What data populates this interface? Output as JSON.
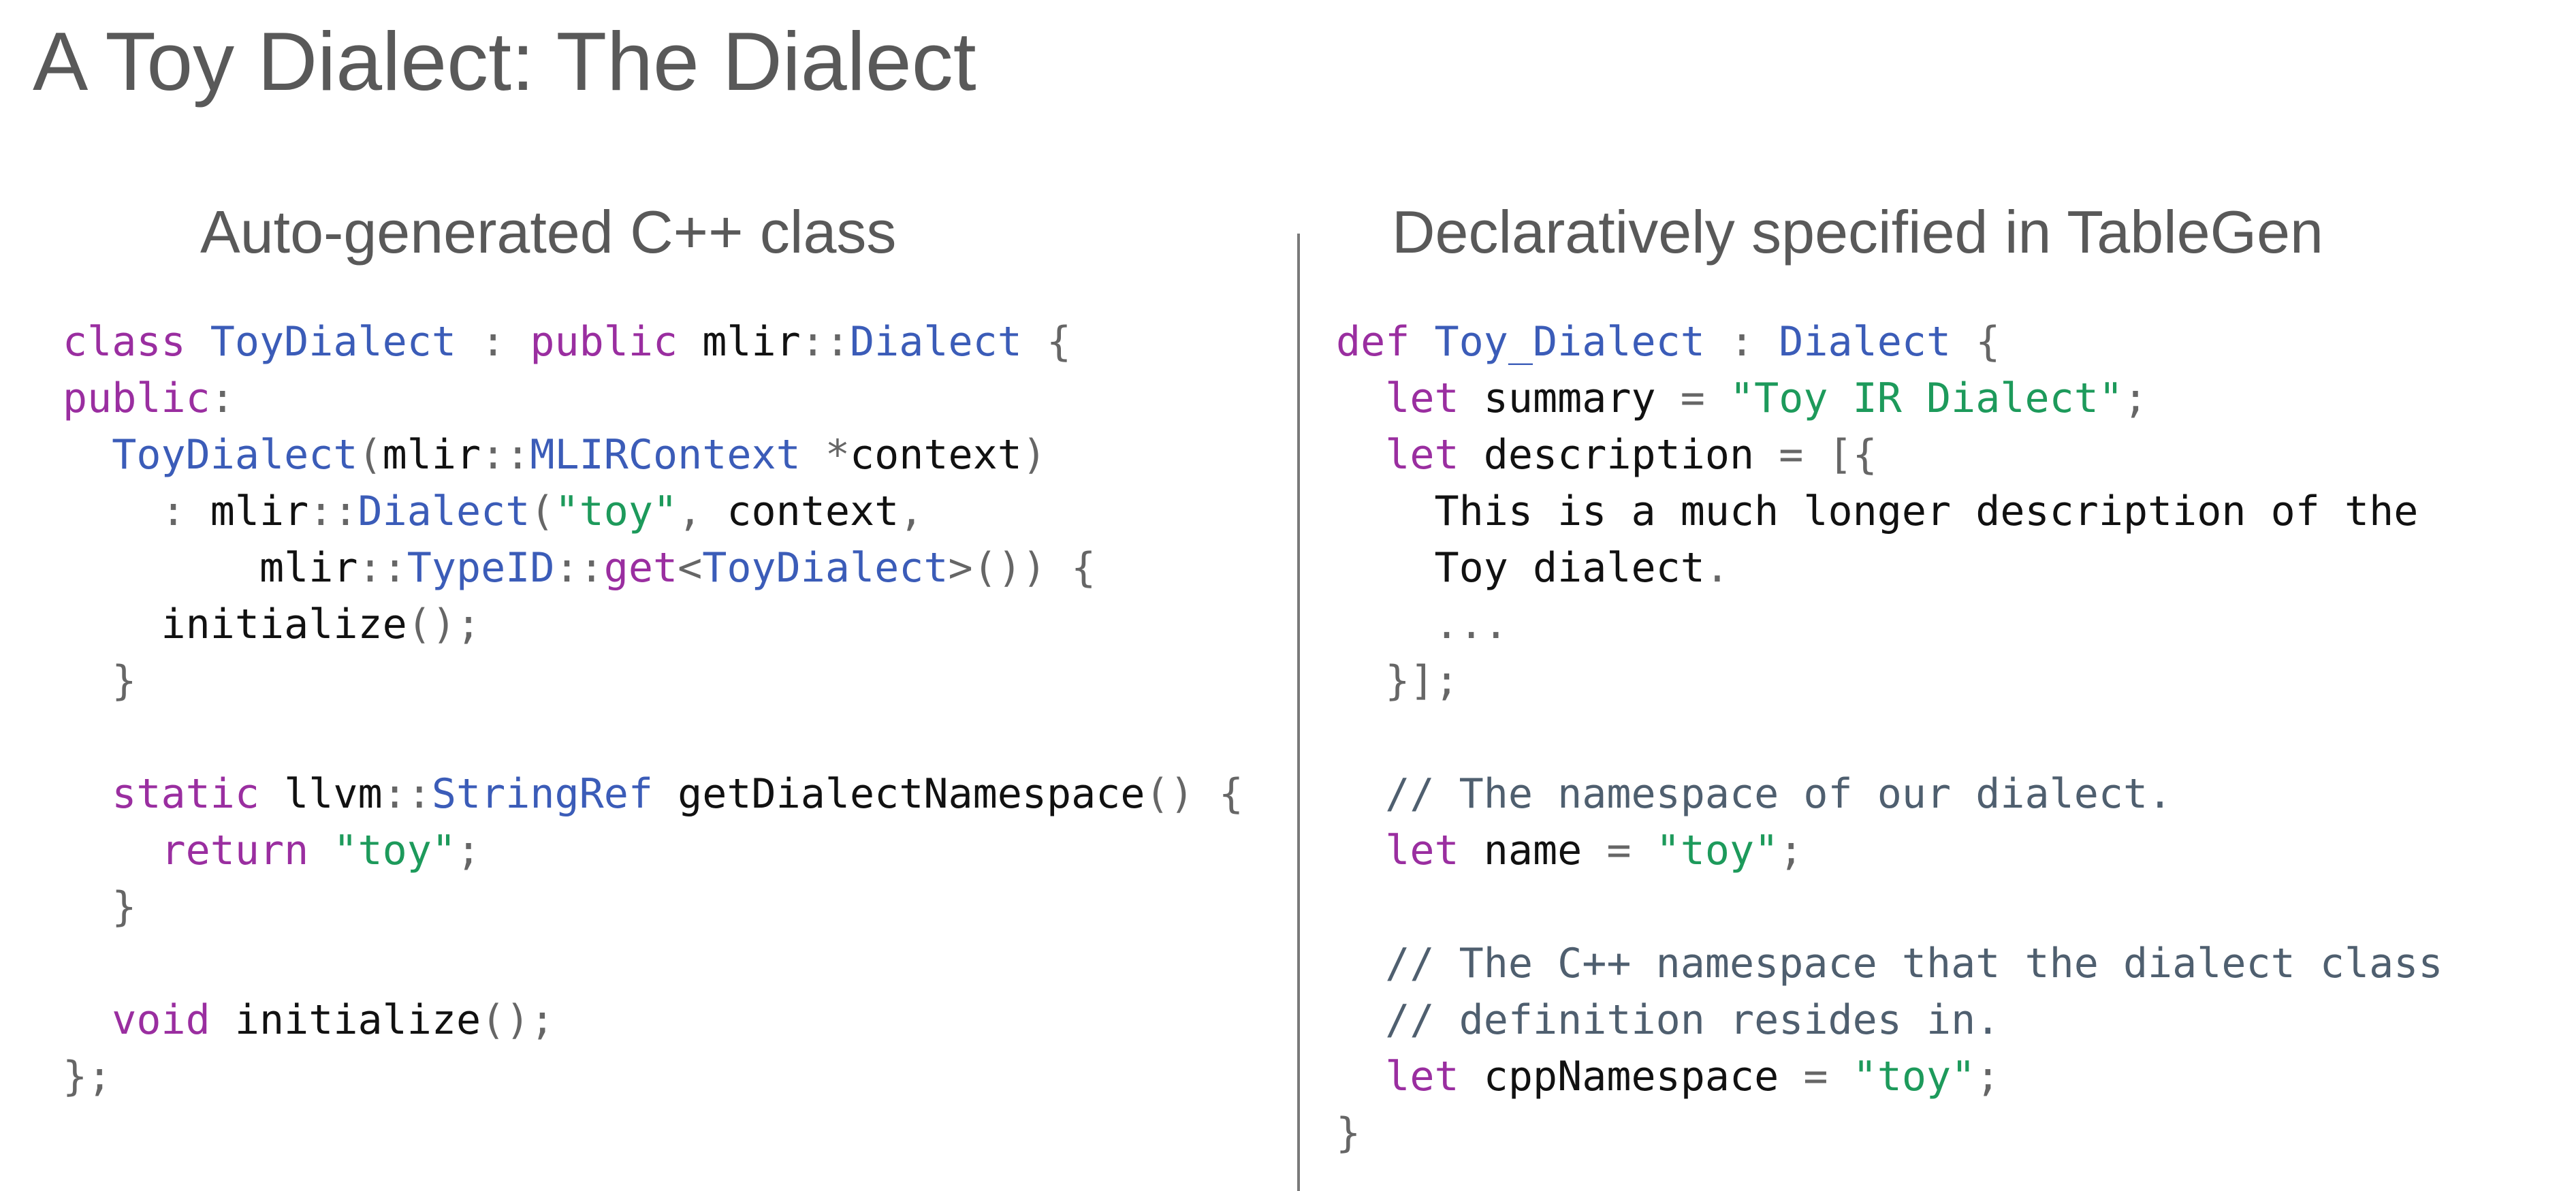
{
  "title": "A Toy Dialect: The Dialect",
  "left": {
    "heading": "Auto-generated C++ class",
    "lines": [
      [
        [
          "k",
          "class"
        ],
        [
          "n",
          " "
        ],
        [
          "t",
          "ToyDialect"
        ],
        [
          "n",
          " "
        ],
        [
          "p",
          ":"
        ],
        [
          "n",
          " "
        ],
        [
          "k",
          "public"
        ],
        [
          "n",
          " mlir"
        ],
        [
          "p",
          "::"
        ],
        [
          "t",
          "Dialect"
        ],
        [
          "n",
          " "
        ],
        [
          "p",
          "{"
        ]
      ],
      [
        [
          "k",
          "public"
        ],
        [
          "p",
          ":"
        ]
      ],
      [
        [
          "n",
          "  "
        ],
        [
          "t",
          "ToyDialect"
        ],
        [
          "p",
          "("
        ],
        [
          "n",
          "mlir"
        ],
        [
          "p",
          "::"
        ],
        [
          "t",
          "MLIRContext"
        ],
        [
          "n",
          " "
        ],
        [
          "p",
          "*"
        ],
        [
          "n",
          "context"
        ],
        [
          "p",
          ")"
        ]
      ],
      [
        [
          "n",
          "    "
        ],
        [
          "p",
          ":"
        ],
        [
          "n",
          " mlir"
        ],
        [
          "p",
          "::"
        ],
        [
          "t",
          "Dialect"
        ],
        [
          "p",
          "("
        ],
        [
          "s",
          "\"toy\""
        ],
        [
          "p",
          ","
        ],
        [
          "n",
          " context"
        ],
        [
          "p",
          ","
        ]
      ],
      [
        [
          "n",
          "        mlir"
        ],
        [
          "p",
          "::"
        ],
        [
          "t",
          "TypeID"
        ],
        [
          "p",
          "::"
        ],
        [
          "k",
          "get"
        ],
        [
          "p",
          "<"
        ],
        [
          "t",
          "ToyDialect"
        ],
        [
          "p",
          ">())"
        ],
        [
          "n",
          " "
        ],
        [
          "p",
          "{"
        ]
      ],
      [
        [
          "n",
          "    initialize"
        ],
        [
          "p",
          "();"
        ]
      ],
      [
        [
          "p",
          "  }"
        ]
      ],
      [],
      [
        [
          "n",
          "  "
        ],
        [
          "k",
          "static"
        ],
        [
          "n",
          " llvm"
        ],
        [
          "p",
          "::"
        ],
        [
          "t",
          "StringRef"
        ],
        [
          "n",
          " getDialectNamespace"
        ],
        [
          "p",
          "()"
        ],
        [
          "n",
          " "
        ],
        [
          "p",
          "{"
        ]
      ],
      [
        [
          "n",
          "    "
        ],
        [
          "k",
          "return"
        ],
        [
          "n",
          " "
        ],
        [
          "s",
          "\"toy\""
        ],
        [
          "p",
          ";"
        ]
      ],
      [
        [
          "p",
          "  }"
        ]
      ],
      [],
      [
        [
          "n",
          "  "
        ],
        [
          "k",
          "void"
        ],
        [
          "n",
          " initialize"
        ],
        [
          "p",
          "();"
        ]
      ],
      [
        [
          "p",
          "};"
        ]
      ]
    ]
  },
  "right": {
    "heading": "Declaratively specified in TableGen",
    "lines": [
      [
        [
          "k",
          "def"
        ],
        [
          "n",
          " "
        ],
        [
          "t",
          "Toy_Dialect"
        ],
        [
          "n",
          " "
        ],
        [
          "p",
          ":"
        ],
        [
          "n",
          " "
        ],
        [
          "t",
          "Dialect"
        ],
        [
          "n",
          " "
        ],
        [
          "p",
          "{"
        ]
      ],
      [
        [
          "n",
          "  "
        ],
        [
          "k",
          "let"
        ],
        [
          "n",
          " summary "
        ],
        [
          "p",
          "="
        ],
        [
          "n",
          " "
        ],
        [
          "s",
          "\"Toy IR Dialect\""
        ],
        [
          "p",
          ";"
        ]
      ],
      [
        [
          "n",
          "  "
        ],
        [
          "k",
          "let"
        ],
        [
          "n",
          " description "
        ],
        [
          "p",
          "="
        ],
        [
          "n",
          " "
        ],
        [
          "p",
          "[{"
        ]
      ],
      [
        [
          "n",
          "    This is a much longer description of the"
        ]
      ],
      [
        [
          "n",
          "    Toy dialect"
        ],
        [
          "p",
          "."
        ]
      ],
      [
        [
          "p",
          "    ..."
        ]
      ],
      [
        [
          "p",
          "  }];"
        ]
      ],
      [],
      [
        [
          "c",
          "  // The namespace of our dialect."
        ]
      ],
      [
        [
          "n",
          "  "
        ],
        [
          "k",
          "let"
        ],
        [
          "n",
          " name "
        ],
        [
          "p",
          "="
        ],
        [
          "n",
          " "
        ],
        [
          "s",
          "\"toy\""
        ],
        [
          "p",
          ";"
        ]
      ],
      [],
      [
        [
          "c",
          "  // The C++ namespace that the dialect class"
        ]
      ],
      [
        [
          "c",
          "  // definition resides in."
        ]
      ],
      [
        [
          "n",
          "  "
        ],
        [
          "k",
          "let"
        ],
        [
          "n",
          " cppNamespace "
        ],
        [
          "p",
          "="
        ],
        [
          "n",
          " "
        ],
        [
          "s",
          "\"toy\""
        ],
        [
          "p",
          ";"
        ]
      ],
      [
        [
          "p",
          "}"
        ]
      ]
    ]
  }
}
